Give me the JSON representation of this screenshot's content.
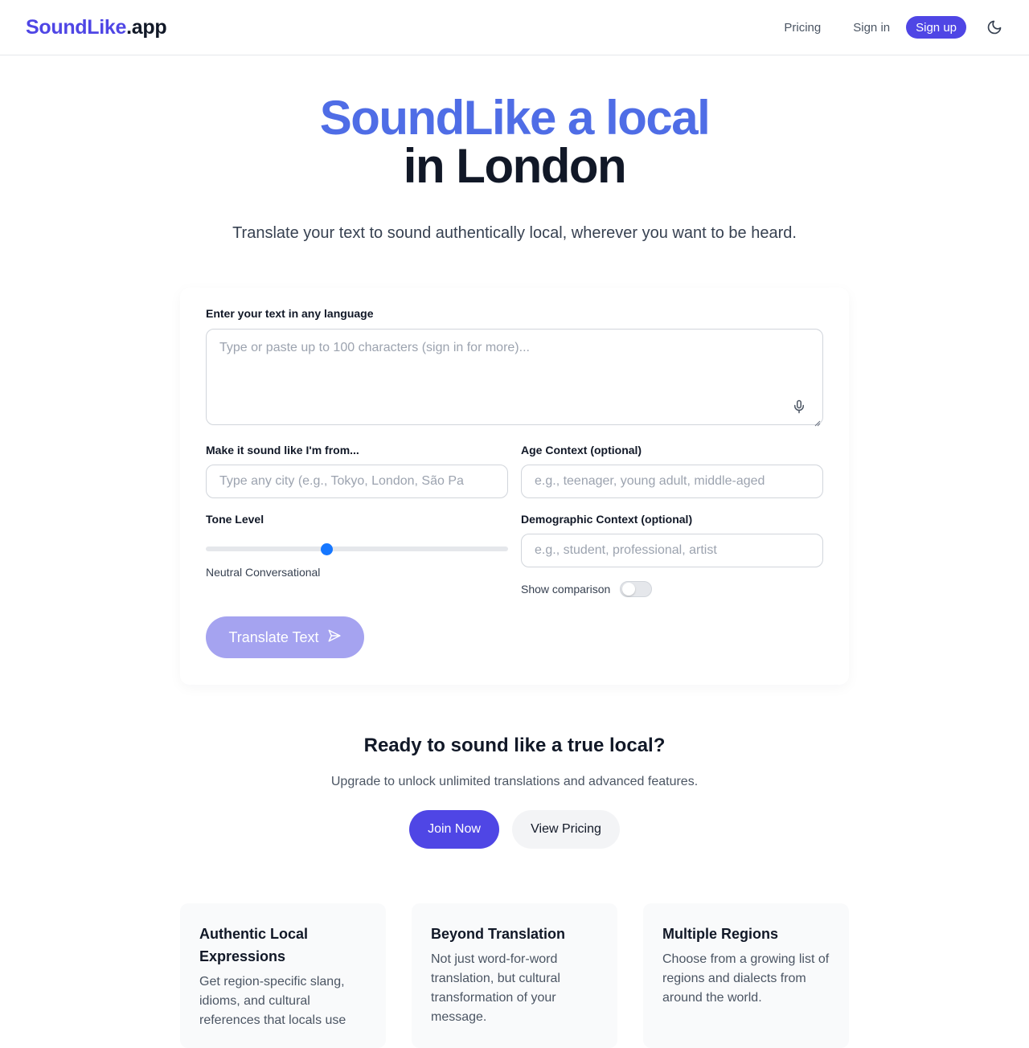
{
  "header": {
    "logo_brand": "SoundLike",
    "logo_tld": ".app",
    "nav_pricing": "Pricing",
    "nav_signin": "Sign in",
    "nav_signup": "Sign up",
    "theme_icon": "moon-icon"
  },
  "hero": {
    "title_line1": "SoundLike a local",
    "title_line2": "in London",
    "subtitle": "Translate your text to sound authentically local, wherever you want to be heard."
  },
  "form": {
    "text_label": "Enter your text in any language",
    "text_placeholder": "Type or paste up to 100 characters (sign in for more)...",
    "city_label": "Make it sound like I'm from...",
    "city_placeholder": "Type any city (e.g., Tokyo, London, São Pa",
    "age_label": "Age Context (optional)",
    "age_placeholder": "e.g., teenager, young adult, middle-aged",
    "tone_label": "Tone Level",
    "tone_fraction": 0.4,
    "tone_value": "Neutral Conversational",
    "demo_label": "Demographic Context (optional)",
    "demo_placeholder": "e.g., student, professional, artist",
    "comparison_label": "Show comparison",
    "comparison_on": false,
    "translate_label": "Translate Text"
  },
  "cta": {
    "title": "Ready to sound like a true local?",
    "subtitle": "Upgrade to unlock unlimited translations and advanced features.",
    "join_label": "Join Now",
    "pricing_label": "View Pricing"
  },
  "features": [
    {
      "title": "Authentic Local Expressions",
      "description": "Get region-specific slang, idioms, and cultural references that locals use"
    },
    {
      "title": "Beyond Translation",
      "description": "Not just word-for-word translation, but cultural transformation of your message."
    },
    {
      "title": "Multiple Regions",
      "description": "Choose from a growing list of regions and dialects from around the world."
    }
  ],
  "colors": {
    "brand": "#4f46e5",
    "hero_accent": "#4f6de6",
    "slider": "#1677ff",
    "translate_disabled": "#a5a3f0"
  }
}
